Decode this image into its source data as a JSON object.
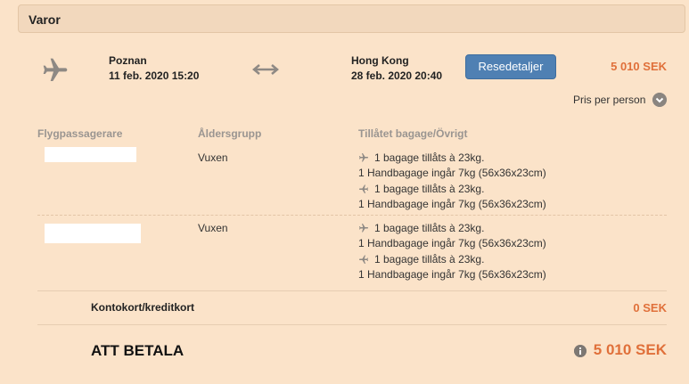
{
  "section": {
    "title": "Varor"
  },
  "flight": {
    "origin_city": "Poznan",
    "departure": "11 feb. 2020 15:20",
    "destination_city": "Hong Kong",
    "arrival": "28 feb. 2020 20:40",
    "details_button": "Resedetaljer",
    "price": "5 010 SEK",
    "price_per_person_label": "Pris per person"
  },
  "table": {
    "headers": [
      "Flygpassagerare",
      "Åldersgrupp",
      "Tillåtet bagage/Övrigt"
    ],
    "passengers": [
      {
        "age_group": "Vuxen",
        "baggage": [
          "1 bagage tillåts à 23kg.",
          "1 Handbagage ingår 7kg (56x36x23cm)",
          "1 bagage tillåts à 23kg.",
          "1 Handbagage ingår 7kg (56x36x23cm)"
        ]
      },
      {
        "age_group": "Vuxen",
        "baggage": [
          "1 bagage tillåts à 23kg.",
          "1 Handbagage ingår 7kg (56x36x23cm)",
          "1 bagage tillåts à 23kg.",
          "1 Handbagage ingår 7kg (56x36x23cm)"
        ]
      }
    ]
  },
  "payment": {
    "label": "Kontokort/kreditkort",
    "amount": "0 SEK"
  },
  "total": {
    "label": "ATT BETALA",
    "amount": "5 010 SEK"
  },
  "colors": {
    "accent": "#e0703a",
    "button": "#4f80b3",
    "background": "#fbe3c9"
  },
  "icons": [
    "airplane-icon",
    "swap-arrows-icon",
    "chevron-down-icon",
    "info-icon"
  ]
}
